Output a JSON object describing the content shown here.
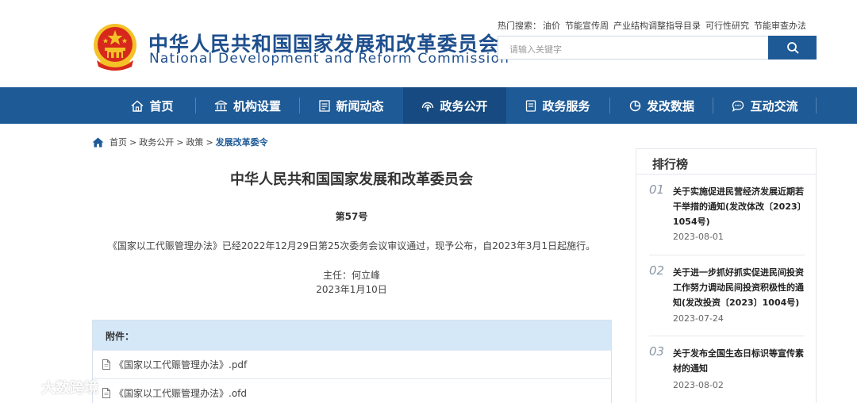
{
  "header": {
    "title_cn": "中华人民共和国国家发展和改革委员会",
    "title_en": "National Development and Reform Commission",
    "hot_label": "热门搜索：",
    "hot_terms": [
      "油价",
      "节能宣传周",
      "产业结构调整指导目录",
      "可行性研究",
      "节能审查办法"
    ],
    "search_placeholder": "请输入关键字"
  },
  "nav": {
    "items": [
      {
        "label": "首页",
        "icon": "home-icon"
      },
      {
        "label": "机构设置",
        "icon": "building-icon"
      },
      {
        "label": "新闻动态",
        "icon": "news-icon"
      },
      {
        "label": "政务公开",
        "icon": "broadcast-icon",
        "active": true
      },
      {
        "label": "政务服务",
        "icon": "document-icon"
      },
      {
        "label": "发改数据",
        "icon": "pie-chart-icon"
      },
      {
        "label": "互动交流",
        "icon": "chat-icon"
      }
    ]
  },
  "breadcrumb": {
    "items": [
      "首页",
      "政务公开",
      "政策",
      "发展改革委令"
    ],
    "separator": ">"
  },
  "article": {
    "title": "中华人民共和国国家发展和改革委员会",
    "doc_no": "第57号",
    "body": "《国家以工代赈管理办法》已经2022年12月29日第25次委务会议审议通过，现予公布，自2023年3月1日起施行。",
    "sign_role": "主任：何立峰",
    "sign_date": "2023年1月10日"
  },
  "attachments": {
    "label": "附件：",
    "files": [
      "《国家以工代赈管理办法》.pdf",
      "《国家以工代赈管理办法》.ofd"
    ]
  },
  "ranking": {
    "title": "排行榜",
    "items": [
      {
        "num": "01",
        "title": "关于实施促进民营经济发展近期若干举措的通知(发改体改〔2023〕1054号)",
        "date": "2023-08-01"
      },
      {
        "num": "02",
        "title": "关于进一步抓好抓实促进民间投资工作努力调动民间投资积极性的通知(发改投资〔2023〕1004号)",
        "date": "2023-07-24"
      },
      {
        "num": "03",
        "title": "关于发布全国生态日标识等宣传素材的通知",
        "date": "2023-08-02"
      }
    ]
  },
  "watermark": "大数跨境",
  "colors": {
    "brand_blue": "#1e5a96",
    "nav_active": "#164a80",
    "attachment_header": "#d5e8f8",
    "emblem_red": "#d7281c",
    "emblem_gold": "#f4c227"
  }
}
